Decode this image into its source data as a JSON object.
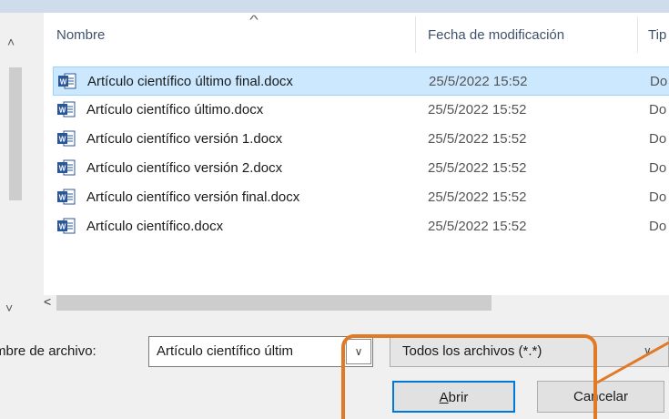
{
  "header": {
    "col_name": "Nombre",
    "col_date": "Fecha de modificación",
    "col_type": "Tip"
  },
  "files": [
    {
      "name": "Artículo científico último final.docx",
      "date": "25/5/2022 15:52",
      "type": "Do",
      "selected": true
    },
    {
      "name": "Artículo científico último.docx",
      "date": "25/5/2022 15:52",
      "type": "Do",
      "selected": false
    },
    {
      "name": "Artículo científico versión 1.docx",
      "date": "25/5/2022 15:52",
      "type": "Do",
      "selected": false
    },
    {
      "name": "Artículo científico versión 2.docx",
      "date": "25/5/2022 15:52",
      "type": "Do",
      "selected": false
    },
    {
      "name": "Artículo científico versión final.docx",
      "date": "25/5/2022 15:52",
      "type": "Do",
      "selected": false
    },
    {
      "name": "Artículo científico.docx",
      "date": "25/5/2022 15:52",
      "type": "Do",
      "selected": false
    }
  ],
  "footer": {
    "filename_label": "mbre de archivo:",
    "filename_value": "Artículo científico últim",
    "filter_value": "Todos los archivos (*.*)",
    "open_label": "Abrir",
    "cancel_label": "Cancelar"
  },
  "icons": {
    "file": "word-document-icon",
    "dropdown": "chevron-down-icon",
    "scroll_left": "chevron-left-icon",
    "sort": "sort-caret-icon"
  },
  "colors": {
    "selection": "#cce8ff",
    "word_blue": "#2b579a",
    "default_button_border": "#0078d7",
    "annotation": "#e07a26"
  }
}
